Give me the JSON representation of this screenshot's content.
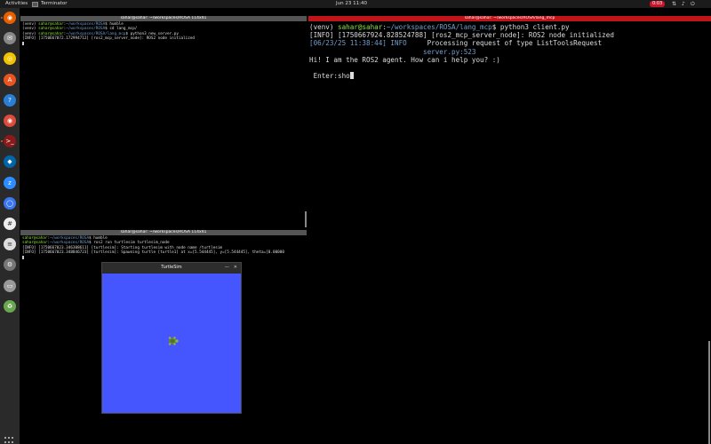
{
  "topbar": {
    "activities": "Activities",
    "app_name": "Terminator",
    "clock": "Jun 23  11:40",
    "indicator": "0:03",
    "system_icons": [
      "network-icon",
      "volume-icon",
      "power-icon"
    ]
  },
  "dock": {
    "apps": [
      {
        "name": "firefox-icon",
        "color": "#e66000",
        "glyph": "◉"
      },
      {
        "name": "mail-icon",
        "color": "#888888",
        "glyph": "✉"
      },
      {
        "name": "rhythmbox-icon",
        "color": "#f2c200",
        "glyph": "◎"
      },
      {
        "name": "software-center-icon",
        "color": "#e95420",
        "glyph": "A"
      },
      {
        "name": "help-icon",
        "color": "#2a7fd4",
        "glyph": "?"
      },
      {
        "name": "chrome-icon",
        "color": "#dd4b39",
        "glyph": "◉"
      },
      {
        "name": "terminal-icon",
        "color": "#8b1a1a",
        "glyph": ">_"
      },
      {
        "name": "vscode-icon",
        "color": "#0065a9",
        "glyph": "◆"
      },
      {
        "name": "zoom-icon",
        "color": "#2d8cff",
        "glyph": "z"
      },
      {
        "name": "signal-icon",
        "color": "#3a76f0",
        "glyph": "◯"
      },
      {
        "name": "slack-icon",
        "color": "#eeeeee",
        "glyph": "#"
      },
      {
        "name": "text-editor-icon",
        "color": "#dddddd",
        "glyph": "≡"
      },
      {
        "name": "settings-icon",
        "color": "#777777",
        "glyph": "⚙"
      },
      {
        "name": "drive-icon",
        "color": "#999999",
        "glyph": "▭"
      },
      {
        "name": "trash-icon",
        "color": "#6aa84f",
        "glyph": "♻"
      }
    ]
  },
  "terminal_top_left": {
    "title": "sahar@sahar: ~/workspaces/ROSA 114x41",
    "lines": [
      [
        {
          "t": "(venv) ",
          "c": "w"
        },
        {
          "t": "sahar@sahar",
          "c": "g"
        },
        {
          "t": ":",
          "c": "w"
        },
        {
          "t": "~/workspaces/ROSA",
          "c": "b"
        },
        {
          "t": "$ humble",
          "c": "w"
        }
      ],
      [
        {
          "t": "(venv) ",
          "c": "w"
        },
        {
          "t": "sahar@sahar",
          "c": "g"
        },
        {
          "t": ":",
          "c": "w"
        },
        {
          "t": "~/workspaces/ROSA",
          "c": "b"
        },
        {
          "t": "$ cd lang_mcp/",
          "c": "w"
        }
      ],
      [
        {
          "t": "(venv) ",
          "c": "w"
        },
        {
          "t": "sahar@sahar",
          "c": "g"
        },
        {
          "t": ":",
          "c": "w"
        },
        {
          "t": "~/workspaces/ROSA/lang_mcp",
          "c": "b"
        },
        {
          "t": "$ python3 new_server.py",
          "c": "w"
        }
      ],
      [
        {
          "t": "[INFO] [1750667072.172994712] [ros2_mcp_server_node]: ROS2 node initialized",
          "c": "w"
        }
      ]
    ]
  },
  "terminal_bottom_left": {
    "title": "sahar@sahar: ~/workspaces/ROSA 114x41",
    "lines": [
      [
        {
          "t": "sahar@sahar",
          "c": "g"
        },
        {
          "t": ":",
          "c": "w"
        },
        {
          "t": "~/workspaces/ROSA",
          "c": "b"
        },
        {
          "t": "$ humble",
          "c": "w"
        }
      ],
      [
        {
          "t": "sahar@sahar",
          "c": "g"
        },
        {
          "t": ":",
          "c": "w"
        },
        {
          "t": "~/workspaces/ROSA",
          "c": "b"
        },
        {
          "t": "$ ros2 run turtlesim turtlesim_node",
          "c": "w"
        }
      ],
      [
        {
          "t": "[INFO] [1750667023.346308611] [turtlesim]: Starting turtlesim with node name /turtlesim",
          "c": "w"
        }
      ],
      [
        {
          "t": "[INFO] [1750667023.348846723] [turtlesim]: Spawning turtle [turtle1] at x=[5.544445], y=[5.544445], theta=[0.00000",
          "c": "w"
        }
      ]
    ]
  },
  "terminal_right": {
    "title": "sahar@sahar: ~/workspaces/ROSA/lang_mcp",
    "lines": [
      [
        {
          "t": "(venv) ",
          "c": "w"
        },
        {
          "t": "sahar@sahar",
          "c": "g"
        },
        {
          "t": ":",
          "c": "w"
        },
        {
          "t": "~/workspaces/ROSA/lang_mcp",
          "c": "b"
        },
        {
          "t": "$ python3 client.py",
          "c": "w"
        }
      ],
      [
        {
          "t": "[INFO] [1750667924.828524788] [ros2_mcp_server_node]: ROS2 node initialized",
          "c": "w"
        }
      ],
      [
        {
          "t": "[06/23/25 11:38:44] INFO",
          "c": "b"
        },
        {
          "t": "     Processing request of type ListToolsRequest",
          "c": "w"
        }
      ],
      [
        {
          "t": "                            server.py:523",
          "c": "b"
        }
      ],
      [
        {
          "t": "Hi! I am the ROS2 agent. How can i help you? :)",
          "c": "w"
        }
      ],
      [
        {
          "t": "",
          "c": "w"
        }
      ],
      [
        {
          "t": " Enter:sho",
          "c": "w"
        }
      ]
    ]
  },
  "turtlesim": {
    "title": "TurtleSim",
    "minimize": "—",
    "close": "✕",
    "background_color": "#4556ff"
  }
}
